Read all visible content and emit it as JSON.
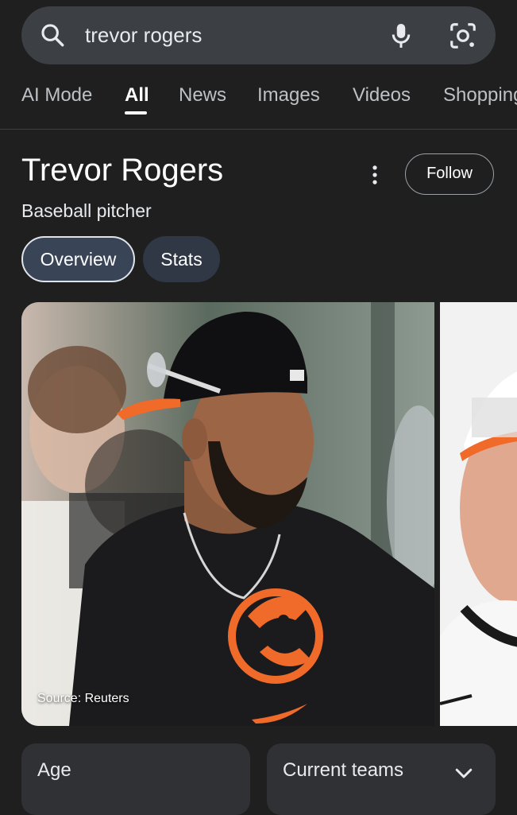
{
  "search": {
    "query": "trevor rogers",
    "icons": [
      "search-icon",
      "mic-icon",
      "lens-icon"
    ]
  },
  "tabs": [
    {
      "label": "AI Mode",
      "active": false
    },
    {
      "label": "All",
      "active": true
    },
    {
      "label": "News",
      "active": false
    },
    {
      "label": "Images",
      "active": false
    },
    {
      "label": "Videos",
      "active": false
    },
    {
      "label": "Shopping",
      "active": false
    }
  ],
  "entity": {
    "title": "Trevor Rogers",
    "subtitle": "Baseball pitcher",
    "follow_label": "Follow"
  },
  "chips": [
    {
      "label": "Overview",
      "selected": true
    },
    {
      "label": "Stats",
      "selected": false
    }
  ],
  "images": {
    "source_caption": "Source: Reuters"
  },
  "cards": {
    "age_label": "Age",
    "teams_label": "Current teams"
  },
  "colors": {
    "background": "#1f1f1f",
    "searchbar": "#3c3f43",
    "chip_selected": "#394457",
    "chip": "#303846",
    "card": "#303134",
    "orioles_orange": "#f06a2a"
  }
}
